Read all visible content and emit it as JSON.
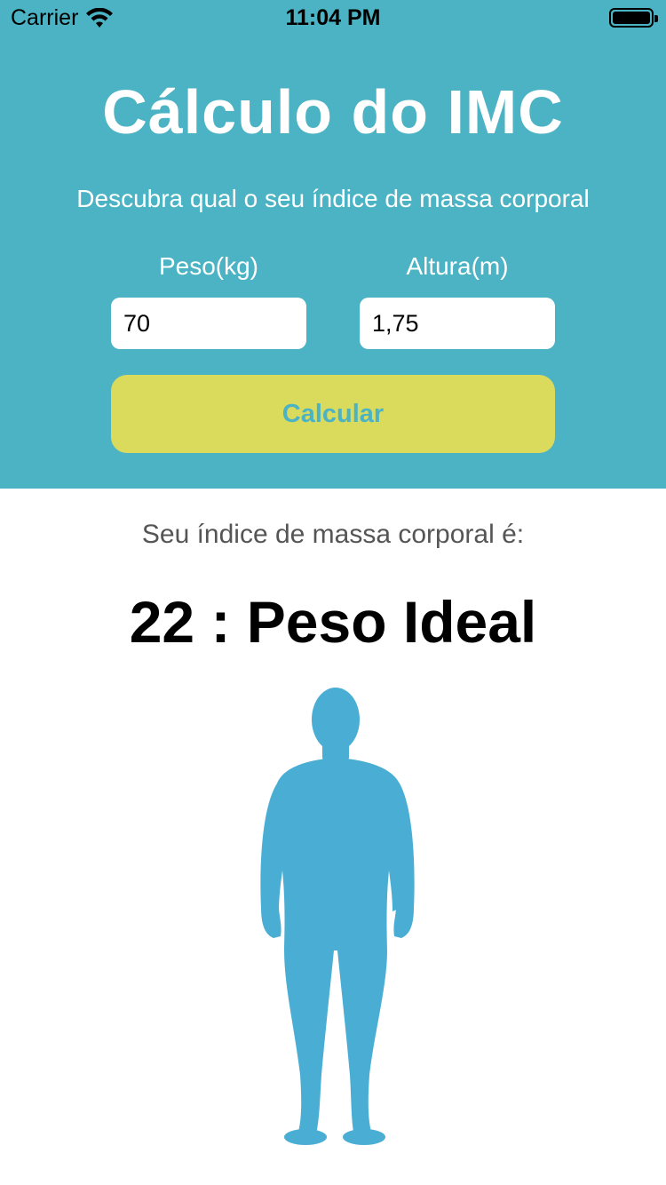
{
  "status_bar": {
    "carrier": "Carrier",
    "time": "11:04 PM"
  },
  "header": {
    "title": "Cálculo do IMC",
    "subtitle": "Descubra qual o seu índice de massa corporal"
  },
  "form": {
    "peso_label": "Peso(kg)",
    "peso_value": "70",
    "altura_label": "Altura(m)",
    "altura_value": "1,75",
    "calcular_label": "Calcular"
  },
  "result": {
    "label": "Seu índice de massa corporal é:",
    "value": "22 : Peso Ideal"
  },
  "icons": {
    "wifi": "wifi-icon",
    "battery": "battery-icon",
    "body": "body-silhouette-icon"
  },
  "colors": {
    "header_bg": "#4bb3c3",
    "button_bg": "#dadb5d",
    "button_text": "#4bb3c3",
    "silhouette": "#4aaed4"
  }
}
